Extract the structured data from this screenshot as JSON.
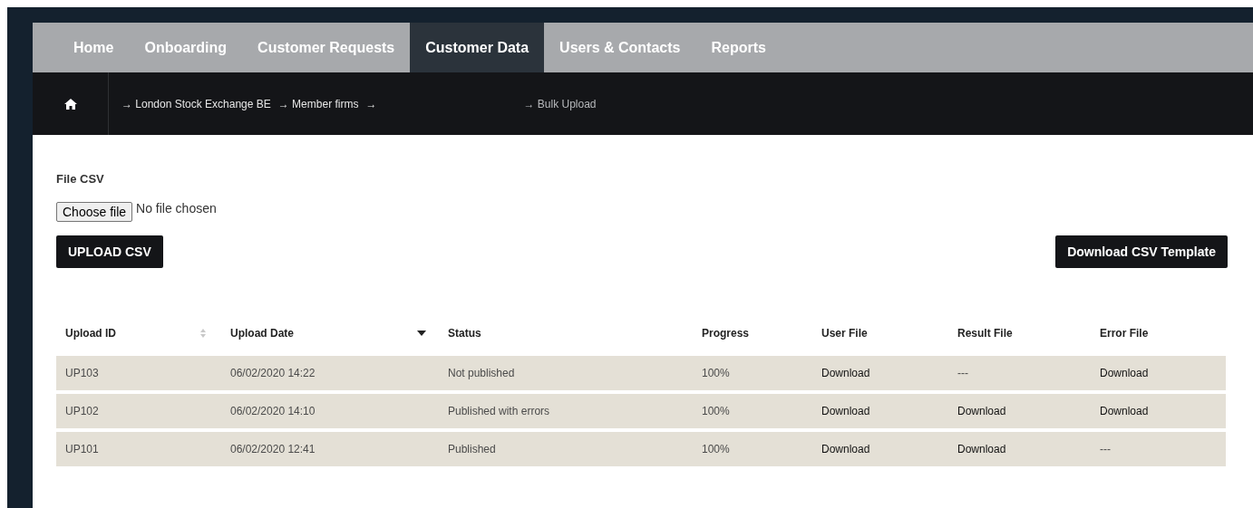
{
  "nav": {
    "tabs": [
      {
        "label": "Home",
        "selected": false
      },
      {
        "label": "Onboarding",
        "selected": false
      },
      {
        "label": "Customer Requests",
        "selected": false
      },
      {
        "label": "Customer Data",
        "selected": true
      },
      {
        "label": "Users & Contacts",
        "selected": false
      },
      {
        "label": "Reports",
        "selected": false
      }
    ]
  },
  "breadcrumb": [
    {
      "label": "→ London Stock Exchange BE",
      "kind": "link"
    },
    {
      "label": "→ Member firms",
      "kind": "link"
    },
    {
      "label": "→",
      "kind": "link"
    },
    {
      "label": "→ Bulk Upload",
      "kind": "current"
    }
  ],
  "form": {
    "label": "File CSV",
    "file_button": "Choose file",
    "file_status": "No file chosen",
    "upload_button": "UPLOAD CSV",
    "template_button": "Download CSV Template"
  },
  "table": {
    "columns": [
      {
        "label": "Upload ID",
        "sorted": false
      },
      {
        "label": "Upload Date",
        "sorted": true
      },
      {
        "label": "Status"
      },
      {
        "label": "Progress"
      },
      {
        "label": "User File"
      },
      {
        "label": "Result File"
      },
      {
        "label": "Error File"
      }
    ],
    "rows": [
      [
        {
          "text": "UP103",
          "kind": "text"
        },
        {
          "text": "06/02/2020 14:22",
          "kind": "text"
        },
        {
          "text": "Not published",
          "kind": "text"
        },
        {
          "text": "100%",
          "kind": "text"
        },
        {
          "text": "Download",
          "kind": "link"
        },
        {
          "text": "---",
          "kind": "text"
        },
        {
          "text": "Download",
          "kind": "link"
        }
      ],
      [
        {
          "text": "UP102",
          "kind": "text"
        },
        {
          "text": "06/02/2020 14:10",
          "kind": "text"
        },
        {
          "text": "Published with errors",
          "kind": "text"
        },
        {
          "text": "100%",
          "kind": "text"
        },
        {
          "text": "Download",
          "kind": "link"
        },
        {
          "text": "Download",
          "kind": "link"
        },
        {
          "text": "Download",
          "kind": "link"
        }
      ],
      [
        {
          "text": "UP101",
          "kind": "text"
        },
        {
          "text": "06/02/2020 12:41",
          "kind": "text"
        },
        {
          "text": "Published",
          "kind": "text"
        },
        {
          "text": "100%",
          "kind": "text"
        },
        {
          "text": "Download",
          "kind": "link"
        },
        {
          "text": "Download",
          "kind": "link"
        },
        {
          "text": "---",
          "kind": "text"
        }
      ]
    ]
  }
}
